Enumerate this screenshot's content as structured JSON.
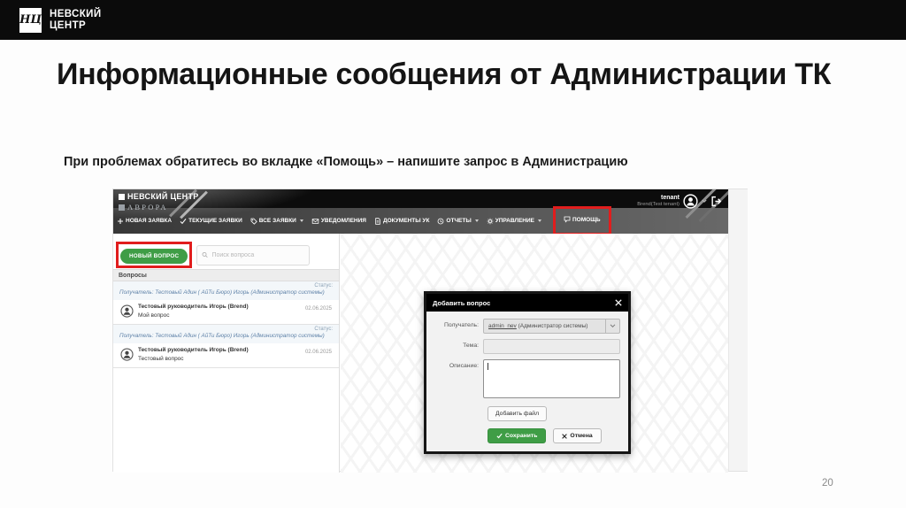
{
  "slide": {
    "topbar": {
      "monogram": "НЦ",
      "brand_line1": "НЕВСКИЙ",
      "brand_line2": "ЦЕНТР"
    },
    "title": "Информационные сообщения от Администрации ТК",
    "subtitle": "При проблемах обратитесь во вкладке «Помощь»  – напишите запрос в Администрацию",
    "page_number": "20"
  },
  "app": {
    "logo": {
      "line1": "НЕВСКИЙ ЦЕНТР",
      "line2": "АВРОРА"
    },
    "nav": [
      {
        "label": "НОВАЯ ЗАЯВКА",
        "icon": "plus-icon"
      },
      {
        "label": "ТЕКУЩИЕ ЗАЯВКИ",
        "icon": "check-icon"
      },
      {
        "label": "ВСЕ ЗАЯВКИ",
        "icon": "tag-icon",
        "caret": true
      },
      {
        "label": "УВЕДОМЛЕНИЯ",
        "icon": "envelope-icon"
      },
      {
        "label": "ДОКУМЕНТЫ УК",
        "icon": "document-icon"
      },
      {
        "label": "ОТЧЕТЫ",
        "icon": "history-icon",
        "caret": true
      },
      {
        "label": "УПРАВЛЕНИЕ",
        "icon": "gear-icon",
        "caret": true
      },
      {
        "label": "ПОМОЩЬ",
        "icon": "chat-icon",
        "active": true,
        "highlighted": true
      }
    ],
    "user": {
      "name": "tenant",
      "org": "Brend(Test tenant)"
    },
    "left_panel": {
      "new_question_button": "НОВЫЙ ВОПРОС",
      "search_placeholder": "Поиск вопроса",
      "list_title": "Вопросы",
      "status_label": "Статус:",
      "items": [
        {
          "recipient": "Получатель: Тестовый Адин ( АйТи Бюро) Игорь (Администратор системы)",
          "author": "Тестовый руководитель Игорь (Brend)",
          "subject": "Мой вопрос",
          "date": "02.06.2025"
        },
        {
          "recipient": "Получатель: Тестовый Адин ( АйТи Бюро) Игорь (Администратор системы)",
          "author": "Тестовый руководитель Игорь (Brend)",
          "subject": "Тестовый вопрос",
          "date": "02.06.2025"
        }
      ]
    },
    "modal": {
      "title": "Добавить вопрос",
      "recipient_label": "Получатель:",
      "recipient_value_user": "admin_nev",
      "recipient_value_rest": " (Администратор системы)",
      "subject_label": "Тема:",
      "description_label": "Описание:",
      "add_file_button": "Добавить файл",
      "save_button": "Сохранить",
      "cancel_button": "Отмена"
    },
    "colors": {
      "accent_green": "#3f9d46",
      "highlight_red": "#e11d1d",
      "header_black": "#0c0c0c"
    }
  }
}
